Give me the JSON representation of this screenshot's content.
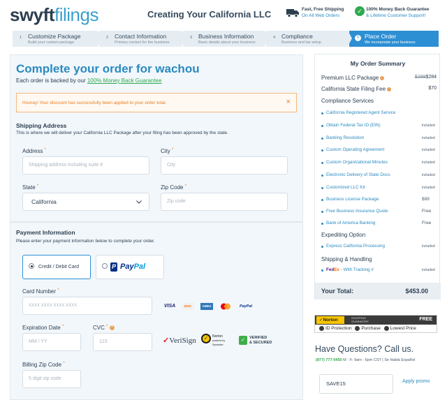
{
  "header": {
    "logo_part1": "swyft",
    "logo_part2": "filings",
    "title": "Creating Your California LLC",
    "shipping_line1": "Fast, Free Shipping",
    "shipping_line2": "On All Web Orders",
    "guarantee_line1": "100% Money Back Guarantee",
    "guarantee_line2": "& Lifetime Customer Support!"
  },
  "steps": [
    {
      "num": "1",
      "title": "Customize Package",
      "sub": "Build your custom package"
    },
    {
      "num": "2",
      "title": "Contact Information",
      "sub": "Primary contact for the business"
    },
    {
      "num": "3",
      "title": "Business Information",
      "sub": "Basic details about your business"
    },
    {
      "num": "4",
      "title": "Compliance",
      "sub": "Business and tax setup"
    },
    {
      "num": "5",
      "title": "Place Order",
      "sub": "We incorporate your business"
    }
  ],
  "main": {
    "title": "Complete your order for wachou",
    "subtitle_prefix": "Each order is backed by our",
    "guarantee_link": "100% Money Back Guarantee",
    "alert": "Hooray! Your discount has successfully been applied to your order total.",
    "alert_close": "×"
  },
  "shipping": {
    "title": "Shipping Address",
    "desc": "This is where we will deliver your California LLC Package after your filing has been approved by the state.",
    "address_label": "Address",
    "address_placeholder": "Shipping address including suite #",
    "city_label": "City",
    "city_placeholder": "City",
    "state_label": "State",
    "state_value": "California",
    "zip_label": "Zip Code",
    "zip_placeholder": "Zip code",
    "required_mark": "*"
  },
  "payment": {
    "title": "Payment Information",
    "desc": "Please enter your payment information below to complete your order.",
    "option_card": "Credit / Debit Card",
    "option_paypal_p1": "Pay",
    "option_paypal_p2": "Pal",
    "card_number_label": "Card Number",
    "card_number_placeholder": "XXXX XXXX XXXX XXXX",
    "card_brands": [
      "VISA",
      "DISC",
      "AMEX",
      "MC",
      "PayPal"
    ],
    "expiration_label": "Expiration Date",
    "expiration_placeholder": "MM / YY",
    "cvc_label": "CVC",
    "cvc_placeholder": "123",
    "billing_zip_label": "Billing Zip Code",
    "billing_zip_placeholder": "5 digit zip code",
    "verisign": "VeriSign",
    "norton_seal_line1": "Norton",
    "norton_seal_line2": "powered by Symantec",
    "secure_line1": "VERIFIED",
    "secure_line2": "& SECURED"
  },
  "summary": {
    "title": "My Order Summary",
    "package_name": "Premium LLC Package",
    "package_old": "$299",
    "package_price": "$284",
    "state_fee_name": "California State Filing Fee",
    "state_fee_price": "$70",
    "compliance_head": "Compliance Services",
    "compliance_items": [
      {
        "name": "California Registered Agent Service",
        "value": ""
      },
      {
        "name": "Obtain Federal Tax ID (EIN)",
        "value": "included"
      },
      {
        "name": "Banking Resolution",
        "value": "included"
      },
      {
        "name": "Custom Operating Agreement",
        "value": "included"
      },
      {
        "name": "Custom Organizational Minutes",
        "value": "included"
      },
      {
        "name": "Electronic Delivery of State Docs",
        "value": "included"
      },
      {
        "name": "Customized LLC Kit",
        "value": "included"
      },
      {
        "name": "Business License Package",
        "value": "$99"
      },
      {
        "name": "Free Business Insurance Quote",
        "value": "Free"
      },
      {
        "name": "Bank of America Banking",
        "value": "Free"
      }
    ],
    "expediting_head": "Expediting Option",
    "expediting_item": "Express California Processing",
    "expediting_value": "included",
    "shipping_head": "Shipping & Handling",
    "fedex_fe": "Fed",
    "fedex_ex": "Ex",
    "shipping_item": " - With Tracking #",
    "shipping_value": "included",
    "total_label": "Your Total:",
    "total_value": "$453.00"
  },
  "norton": {
    "logo": "Norton",
    "sg_line1": "SHOPPING",
    "sg_line2": "GUARANTEE",
    "free": "FREE",
    "benefit1": "ID Protection",
    "benefit2": "Purchase",
    "benefit3": "Lowest Price"
  },
  "contact": {
    "heading": "Have Questions? Call us.",
    "phone": "(877) 777-0450",
    "hours": " M - F: 9am - 6pm CST | Se Habla Español"
  },
  "promo": {
    "code_value": "SAVE15",
    "apply_label": "Apply promo"
  },
  "colors": {
    "accent": "#2a8ac0",
    "active_step": "#2c8fd4",
    "success": "#2eaa4f",
    "warning": "#e67e22"
  }
}
